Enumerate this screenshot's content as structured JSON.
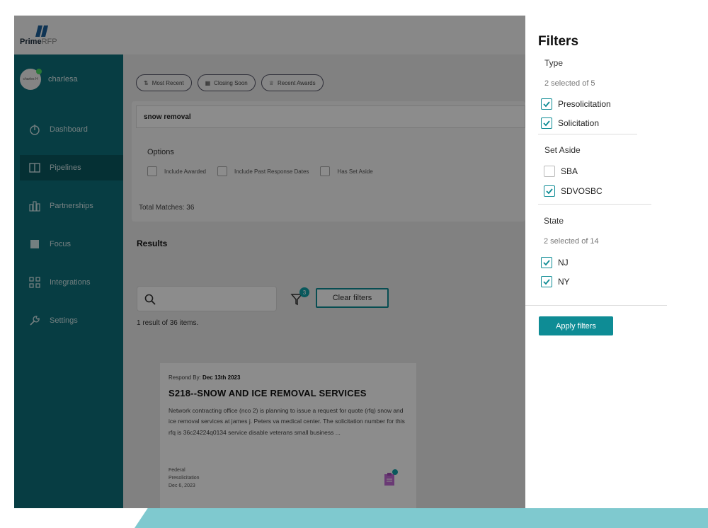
{
  "colors": {
    "sidebar": "#0e6f7a",
    "accent": "#0e8c95",
    "decor": "#7fc9cf",
    "overlay": "rgba(0,0,0,0.45)"
  },
  "logo": {
    "brand_bold": "Prime",
    "brand_light": "RFP"
  },
  "user": {
    "name": "charlesa",
    "avatar_text": "charles H"
  },
  "nav": [
    {
      "label": "Dashboard",
      "icon": "dashboard-icon"
    },
    {
      "label": "Pipelines",
      "icon": "pipelines-icon"
    },
    {
      "label": "Partnerships",
      "icon": "partnerships-icon"
    },
    {
      "label": "Focus",
      "icon": "focus-icon"
    },
    {
      "label": "Integrations",
      "icon": "integrations-icon"
    },
    {
      "label": "Settings",
      "icon": "settings-icon"
    }
  ],
  "quick_filters": [
    "Most Recent",
    "Closing Soon",
    "Recent Awards"
  ],
  "search": {
    "query": "snow removal"
  },
  "options": {
    "title": "Options",
    "items": [
      "Include Awarded",
      "Include Past Response Dates",
      "Has Set Aside"
    ]
  },
  "total_matches": "Total Matches: 36",
  "results": {
    "title": "Results",
    "filter_badge": "3",
    "clear_filters": "Clear filters",
    "count_text": "1 result of 36 items."
  },
  "card": {
    "respond_label": "Respond By:",
    "respond_date": "Dec 13th 2023",
    "title": "S218--SNOW AND ICE REMOVAL SERVICES",
    "description": "Network contracting office (nco 2) is planning to issue a request for quote (rfq) snow and ice removal services at james j. Peters va medical center. The solicitation number for this rfq is 36c24224q0134 service disable veterans small business ...",
    "meta": [
      "Federal",
      "Presolicitation",
      "Dec 6, 2023"
    ]
  },
  "filters": {
    "title": "Filters",
    "type": {
      "label": "Type",
      "summary": "2 selected of 5",
      "options": [
        {
          "label": "Presolicitation",
          "checked": true
        },
        {
          "label": "Solicitation",
          "checked": true
        }
      ]
    },
    "set_aside": {
      "label": "Set Aside",
      "options": [
        {
          "label": "SBA",
          "checked": false
        },
        {
          "label": "SDVOSBC",
          "checked": true
        }
      ]
    },
    "state": {
      "label": "State",
      "summary": "2 selected of 14",
      "options": [
        {
          "label": "NJ",
          "checked": true
        },
        {
          "label": "NY",
          "checked": true
        }
      ]
    },
    "apply_label": "Apply filters"
  }
}
